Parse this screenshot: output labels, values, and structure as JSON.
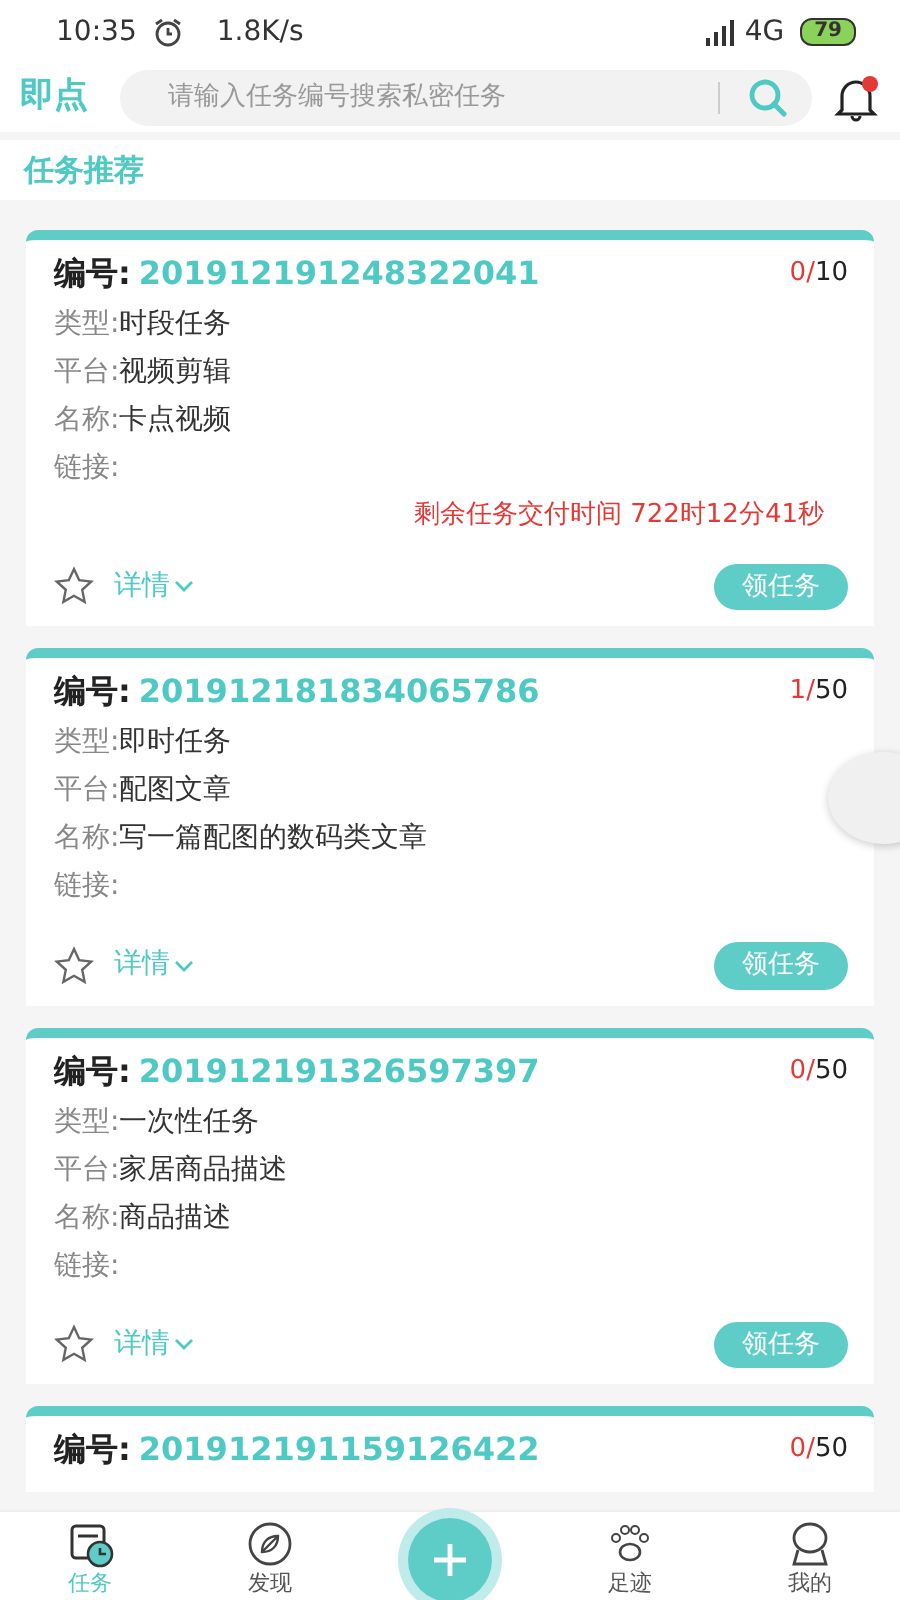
{
  "status_bar": {
    "time": "10:35",
    "speed": "1.8K/s",
    "network": "4G",
    "battery": "79"
  },
  "header": {
    "logo": "即点",
    "search_placeholder": "请输入任务编号搜索私密任务",
    "has_notification": true
  },
  "section_title": "任务推荐",
  "tasks": [
    {
      "id_label": "编号:",
      "id": "201912191248322041",
      "taken": "0/",
      "total": "10",
      "rows": [
        {
          "label": "类型:",
          "value": "时段任务"
        },
        {
          "label": "平台:",
          "value": "视频剪辑"
        },
        {
          "label": "名称:",
          "value": "卡点视频"
        },
        {
          "label": "链接:",
          "value": ""
        }
      ],
      "countdown": "剩余任务交付时间 722时12分41秒",
      "favorited": false,
      "detail": "详情",
      "action": "领任务"
    },
    {
      "id_label": "编号:",
      "id": "201912181834065786",
      "taken": "1/",
      "total": "50",
      "rows": [
        {
          "label": "类型:",
          "value": "即时任务"
        },
        {
          "label": "平台:",
          "value": "配图文章"
        },
        {
          "label": "名称:",
          "value": "写一篇配图的数码类文章"
        },
        {
          "label": "链接:",
          "value": ""
        }
      ],
      "favorited": false,
      "detail": "详情",
      "action": "领任务"
    },
    {
      "id_label": "编号:",
      "id": "201912191326597397",
      "taken": "0/",
      "total": "50",
      "rows": [
        {
          "label": "类型:",
          "value": "一次性任务"
        },
        {
          "label": "平台:",
          "value": "家居商品描述"
        },
        {
          "label": "名称:",
          "value": "商品描述"
        },
        {
          "label": "链接:",
          "value": ""
        }
      ],
      "favorited": false,
      "detail": "详情",
      "action": "领任务"
    },
    {
      "id_label": "编号:",
      "id": "201912191159126422",
      "taken": "0/",
      "total": "50"
    }
  ],
  "nav": [
    {
      "kind": "tasks",
      "label": "任务",
      "selected": true
    },
    {
      "kind": "discover",
      "label": "发现",
      "selected": false
    },
    {
      "kind": "add"
    },
    {
      "kind": "footprint",
      "label": "足迹",
      "selected": false
    },
    {
      "kind": "me",
      "label": "我的",
      "selected": false
    }
  ]
}
